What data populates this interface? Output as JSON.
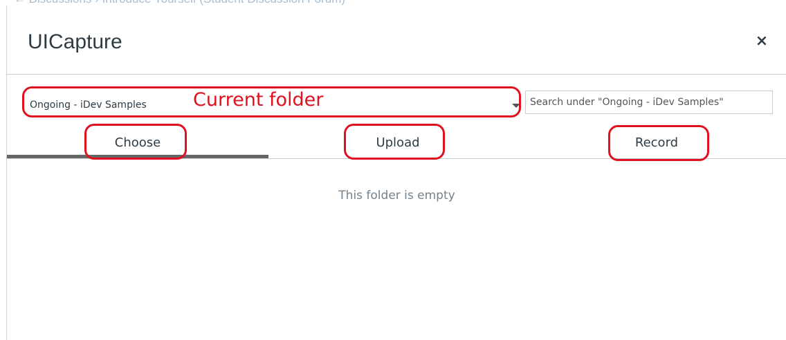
{
  "background": {
    "breadcrumb": "← Discussions › Introduce Yourself (Student Discussion Forum)"
  },
  "modal": {
    "title": "UICapture",
    "close_glyph": "×"
  },
  "folder_select": {
    "value": "Ongoing - iDev Samples"
  },
  "search": {
    "placeholder": "Search under \"Ongoing - iDev Samples\""
  },
  "tabs": [
    {
      "label": "Choose",
      "active": true
    },
    {
      "label": "Upload",
      "active": false
    },
    {
      "label": "Record",
      "active": false
    }
  ],
  "content": {
    "empty_message": "This folder is empty"
  },
  "annotations": {
    "folder_label": "Current folder",
    "color": "#e0101e"
  },
  "colors": {
    "text": "#2d3b45",
    "divider": "#c7cdd1",
    "active_tab_bar": "#666666"
  }
}
